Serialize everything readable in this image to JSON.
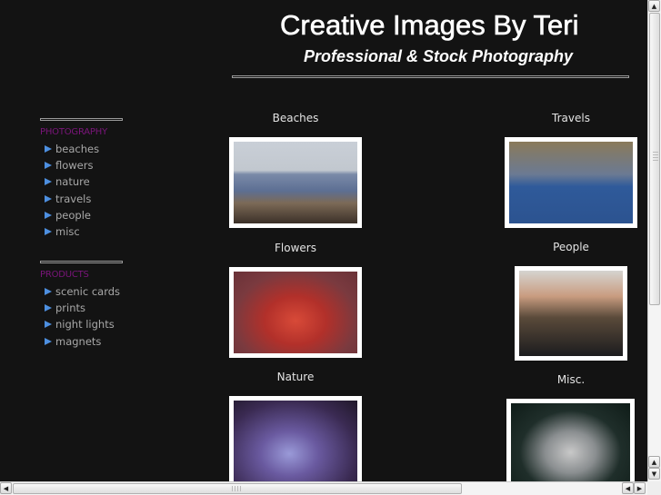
{
  "header": {
    "title": "Creative Images By Teri",
    "subtitle": "Professional & Stock Photography"
  },
  "sidebar": {
    "sections": [
      {
        "heading": "PHOTOGRAPHY",
        "items": [
          {
            "label": "beaches",
            "icon": "arrow-right-icon"
          },
          {
            "label": "flowers",
            "icon": "arrow-right-icon"
          },
          {
            "label": "nature",
            "icon": "arrow-right-icon"
          },
          {
            "label": "travels",
            "icon": "arrow-right-icon"
          },
          {
            "label": "people",
            "icon": "arrow-right-icon"
          },
          {
            "label": "misc",
            "icon": "arrow-right-icon"
          }
        ]
      },
      {
        "heading": "PRODUCTS",
        "items": [
          {
            "label": "scenic cards",
            "icon": "arrow-right-icon"
          },
          {
            "label": "prints",
            "icon": "arrow-right-icon"
          },
          {
            "label": "night lights",
            "icon": "arrow-right-icon"
          },
          {
            "label": "magnets",
            "icon": "arrow-right-icon"
          }
        ]
      }
    ]
  },
  "gallery": {
    "items": [
      {
        "caption": "Beaches",
        "image": "beach coastline photo"
      },
      {
        "caption": "Travels",
        "image": "harbor with sailboats photo"
      },
      {
        "caption": "Flowers",
        "image": "red tulips photo"
      },
      {
        "caption": "People",
        "image": "smiling man with sunglasses photo"
      },
      {
        "caption": "Nature",
        "image": "pufferfish on reef photo"
      },
      {
        "caption": "Misc.",
        "image": "aerial boats at dock photo"
      }
    ]
  },
  "colors": {
    "background": "#131313",
    "section_heading": "#7a157a",
    "nav_text": "#a8a8a8",
    "nav_arrow": "#4d8fe0",
    "title": "#ffffff"
  },
  "scrollbars": {
    "up_arrow": "▲",
    "down_arrow": "▼",
    "left_arrow": "◀",
    "right_arrow": "▶"
  }
}
